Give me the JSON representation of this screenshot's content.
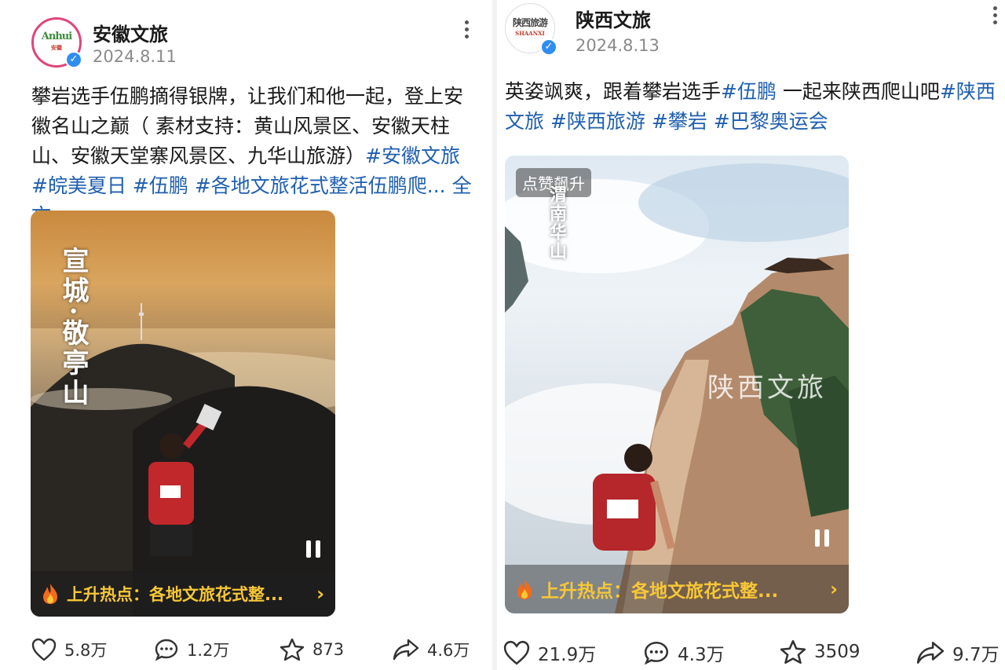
{
  "cards": [
    {
      "account": {
        "name": "安徽文旅",
        "date": "2024.8.11",
        "avatar_text": "Anhui",
        "avatar_sub": "安徽"
      },
      "text": {
        "main": "攀岩选手伍鹏摘得银牌，让我们和他一起，登上安徽名山之巅（ 素材支持：黄山风景区、安徽天柱山、安徽天堂寨风景区、九华山旅游）",
        "tags": [
          "#安徽文旅",
          "#皖美夏日",
          "#伍鹏",
          "#各地文旅花式整活伍鹏爬..."
        ],
        "more": "全文"
      },
      "video": {
        "caption": "宣城·敬亭山",
        "hot": "上升热点：各地文旅花式整..."
      },
      "stats": {
        "likes": "5.8万",
        "comments": "1.2万",
        "favorites": "873",
        "shares": "4.6万"
      }
    },
    {
      "account": {
        "name": "陕西文旅",
        "date": "2024.8.13",
        "avatar_text": "陕西旅游",
        "avatar_sub": "SHAANXI"
      },
      "text": {
        "main": "英姿飒爽，跟着攀岩选手",
        "tags": [
          "#伍鹏",
          "#陕西文旅",
          "#陕西旅游",
          "#攀岩",
          "#巴黎奥运会"
        ],
        "mid": "一起来陕西爬山吧"
      },
      "video": {
        "badge": "点赞飙升",
        "caption": "渭南华山",
        "watermark": "陕西文旅",
        "hot": "上升热点：各地文旅花式整..."
      },
      "stats": {
        "likes": "21.9万",
        "comments": "4.3万",
        "favorites": "3509",
        "shares": "9.7万"
      }
    }
  ],
  "colors": {
    "tag": "#1f5fb0",
    "hot": "#f7c736",
    "verify": "#2f8ef0"
  },
  "icons": [
    "heart-icon",
    "comment-icon",
    "star-icon",
    "share-icon",
    "flame-icon",
    "pause-icon",
    "chevron-right-icon",
    "more-icon",
    "verified-icon"
  ]
}
